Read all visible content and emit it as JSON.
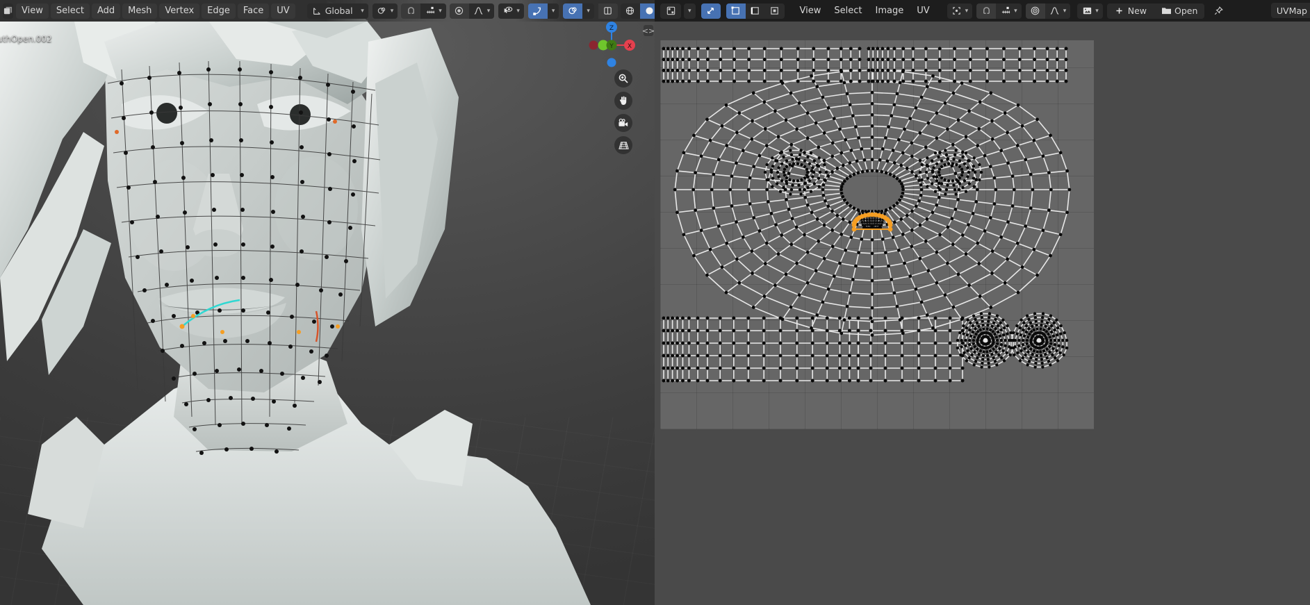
{
  "app": {
    "name": "Blender",
    "theme_bg": "#303030",
    "accent": "#4772b3",
    "select_orange": "#f59e23"
  },
  "viewport3d": {
    "object_name_overlay": "uthOpen.002",
    "mode_icon": "editmode-icon",
    "menus": [
      {
        "label": "View",
        "name": "menu-view"
      },
      {
        "label": "Select",
        "name": "menu-select"
      },
      {
        "label": "Add",
        "name": "menu-add"
      },
      {
        "label": "Mesh",
        "name": "menu-mesh"
      },
      {
        "label": "Vertex",
        "name": "menu-vertex"
      },
      {
        "label": "Edge",
        "name": "menu-edge"
      },
      {
        "label": "Face",
        "name": "menu-face"
      },
      {
        "label": "UV",
        "name": "menu-uv"
      }
    ],
    "transform_orientation": {
      "label": "Global",
      "icon": "orientation-icon"
    },
    "pivot": {
      "icon": "pivot-icon"
    },
    "snap": {
      "icon": "magnet-icon",
      "target_icon": "snap-increment-icon",
      "enabled": false
    },
    "proportional": {
      "icon": "proportional-icon",
      "falloff_icon": "falloff-smooth-icon",
      "enabled": false
    },
    "overlays": {
      "visibility_icon": "show-hide-icon",
      "gizmo_icon": "gizmo-icon",
      "gizmo_on": true
    },
    "shading_modes": [
      {
        "name": "shading-wireframe",
        "icon": "wireframe-sphere",
        "active": false
      },
      {
        "name": "shading-solid",
        "icon": "solid-sphere",
        "active": true
      },
      {
        "name": "shading-material",
        "icon": "material-sphere",
        "active": false
      },
      {
        "name": "shading-rendered",
        "icon": "rendered-sphere",
        "active": false
      }
    ],
    "xray": {
      "name": "toggle-xray",
      "active": true
    },
    "overlay_toggle": {
      "name": "toggle-overlays",
      "active": false
    },
    "nav_gizmo": {
      "axes": [
        {
          "label": "Z",
          "color": "#2f83e3",
          "name": "gizmo-axis-z"
        },
        {
          "label": "X",
          "color": "#e5404e",
          "name": "gizmo-axis-x"
        },
        {
          "label": "Y",
          "color": "#6fc62c",
          "name": "gizmo-axis-y"
        }
      ]
    },
    "nav_buttons": [
      {
        "name": "zoom-view-button",
        "icon": "magnifier-icon"
      },
      {
        "name": "move-view-button",
        "icon": "hand-icon"
      },
      {
        "name": "camera-view-button",
        "icon": "camera-icon"
      },
      {
        "name": "toggle-ortho-button",
        "icon": "grid-perspective-icon"
      }
    ],
    "sidebar_tab": {
      "name": "sidebar-toggle",
      "glyph": "<>"
    }
  },
  "uv_editor": {
    "editor_type_icon": "uv-editor-icon",
    "uv_sync_selection": {
      "name": "uv-sync-selection",
      "icon": "sync-arrows-icon",
      "active": true
    },
    "select_modes": [
      {
        "name": "uv-select-vertex",
        "icon": "vertex-select-icon",
        "active": true
      },
      {
        "name": "uv-select-edge",
        "icon": "edge-select-icon",
        "active": false
      },
      {
        "name": "uv-select-face",
        "icon": "face-select-icon",
        "active": false
      }
    ],
    "menus": [
      {
        "label": "View",
        "name": "uv-menu-view"
      },
      {
        "label": "Select",
        "name": "uv-menu-select"
      },
      {
        "label": "Image",
        "name": "uv-menu-image"
      },
      {
        "label": "UV",
        "name": "uv-menu-uv"
      }
    ],
    "pivot": {
      "icon": "pivot-bounding-icon"
    },
    "snap": {
      "icon": "magnet-icon",
      "target_icon": "snap-increment-icon",
      "enabled": false
    },
    "proportional": {
      "icon": "proportional-icon",
      "falloff_icon": "falloff-smooth-icon",
      "enabled": false
    },
    "image_browse": {
      "icon": "image-icon"
    },
    "new_button": {
      "label": "New",
      "icon": "plus-icon"
    },
    "open_button": {
      "label": "Open",
      "icon": "folder-icon"
    },
    "pin_button": {
      "name": "pin-id-button",
      "icon": "pin-icon"
    },
    "uv_map_field": {
      "value": "UVMap"
    },
    "canvas": {
      "background": "#4a4a4a",
      "image_bg": "#666666",
      "grid": true,
      "vertex_color": "#0a0a0a",
      "edge_color": "#e8e8e8",
      "selected_color": "#f59e23",
      "islands": [
        {
          "name": "uv-island-top-left-strip",
          "kind": "strip"
        },
        {
          "name": "uv-island-top-right-strip",
          "kind": "strip"
        },
        {
          "name": "uv-island-face",
          "kind": "face"
        },
        {
          "name": "uv-island-bottom-strip",
          "kind": "strip"
        },
        {
          "name": "uv-island-ear-left",
          "kind": "circle"
        },
        {
          "name": "uv-island-ear-right",
          "kind": "circle"
        }
      ],
      "selection": {
        "name": "uv-selected-loop",
        "description": "mouth loop selected"
      }
    }
  }
}
